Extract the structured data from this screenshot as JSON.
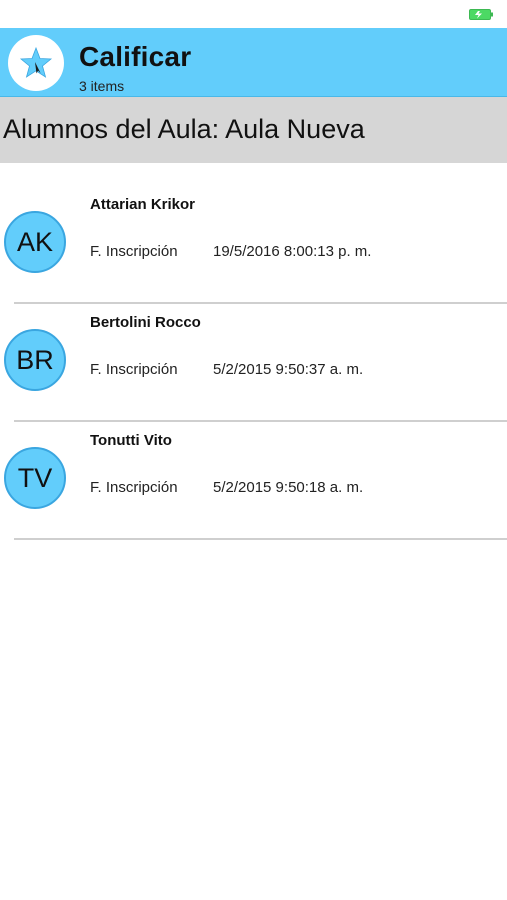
{
  "status_bar": {
    "battery_icon": "battery-charging-icon",
    "battery_color": "#4cd964"
  },
  "app_bar": {
    "logo_icon": "star-icon",
    "title": "Calificar",
    "subtitle": "3 items",
    "accent_color": "#62cdfb"
  },
  "section": {
    "title": "Alumnos del Aula: Aula Nueva"
  },
  "students": [
    {
      "initials": "AK",
      "name": "Attarian Krikor",
      "field_label": "F. Inscripción",
      "enrolled": "19/5/2016 8:00:13 p. m."
    },
    {
      "initials": "BR",
      "name": "Bertolini Rocco",
      "field_label": "F. Inscripción",
      "enrolled": "5/2/2015 9:50:37 a. m."
    },
    {
      "initials": "TV",
      "name": "Tonutti Vito",
      "field_label": "F. Inscripción",
      "enrolled": "5/2/2015 9:50:18 a. m."
    }
  ]
}
